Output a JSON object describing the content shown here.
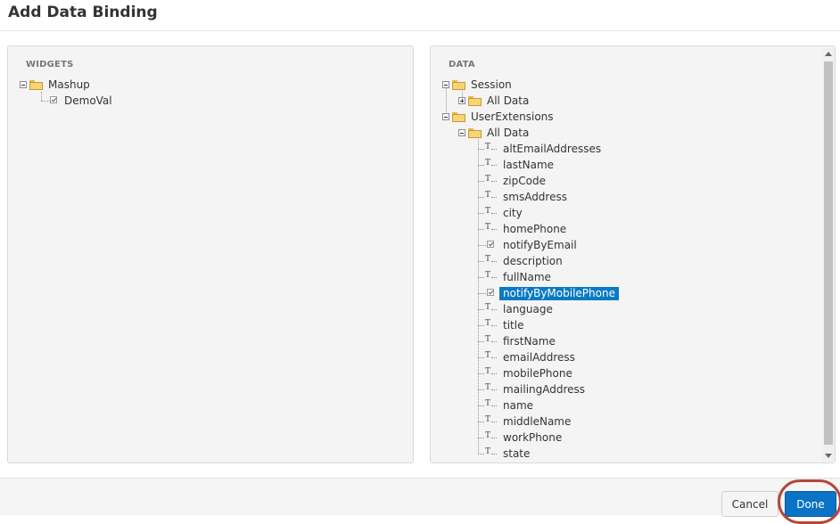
{
  "dialog": {
    "title": "Add Data Binding"
  },
  "widgets_panel": {
    "heading": "WIDGETS",
    "root": {
      "label": "Mashup",
      "icon": "folder-icon",
      "expanded": true
    },
    "children": [
      {
        "label": "DemoVal",
        "icon": "checkbox-icon"
      }
    ]
  },
  "data_panel": {
    "heading": "DATA",
    "session": {
      "label": "Session",
      "icon": "folder-icon",
      "expanded": true
    },
    "session_all_data": {
      "label": "All Data",
      "icon": "folder-icon",
      "expanded": false
    },
    "user_extensions": {
      "label": "UserExtensions",
      "icon": "folder-icon",
      "expanded": true
    },
    "user_extensions_all_data": {
      "label": "All Data",
      "icon": "folder-icon",
      "expanded": true
    },
    "fields": [
      {
        "label": "altEmailAddresses",
        "type": "text"
      },
      {
        "label": "lastName",
        "type": "text"
      },
      {
        "label": "zipCode",
        "type": "text"
      },
      {
        "label": "smsAddress",
        "type": "text"
      },
      {
        "label": "city",
        "type": "text"
      },
      {
        "label": "homePhone",
        "type": "text"
      },
      {
        "label": "notifyByEmail",
        "type": "boolean"
      },
      {
        "label": "description",
        "type": "text"
      },
      {
        "label": "fullName",
        "type": "text"
      },
      {
        "label": "notifyByMobilePhone",
        "type": "boolean",
        "selected": true
      },
      {
        "label": "language",
        "type": "text"
      },
      {
        "label": "title",
        "type": "text"
      },
      {
        "label": "firstName",
        "type": "text"
      },
      {
        "label": "emailAddress",
        "type": "text"
      },
      {
        "label": "mobilePhone",
        "type": "text"
      },
      {
        "label": "mailingAddress",
        "type": "text"
      },
      {
        "label": "name",
        "type": "text"
      },
      {
        "label": "middleName",
        "type": "text"
      },
      {
        "label": "workPhone",
        "type": "text"
      },
      {
        "label": "state",
        "type": "text"
      }
    ],
    "text_icon_glyph": "T"
  },
  "footer": {
    "cancel_label": "Cancel",
    "done_label": "Done"
  },
  "colors": {
    "selection": "#0a7ac2",
    "primary_button": "#0a73c6",
    "highlight_ring": "#b5473a"
  }
}
